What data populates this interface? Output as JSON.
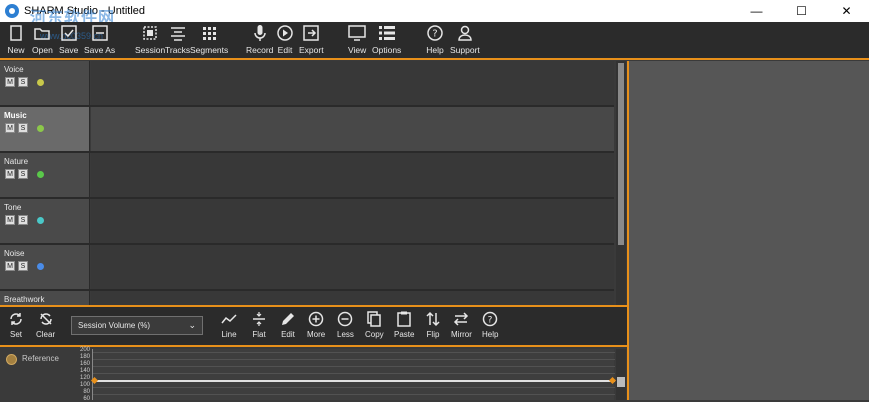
{
  "window": {
    "title": "SHARM Studio - Untitled",
    "watermark": "河东软件网",
    "watermark_url": "www.pc0359.cn",
    "controls": [
      "—",
      "☐",
      "✕"
    ]
  },
  "toolbar": {
    "buttons": [
      {
        "label": "New",
        "icon": "new-file-icon"
      },
      {
        "label": "Open",
        "icon": "folder-open-icon"
      },
      {
        "label": "Save",
        "icon": "save-icon"
      },
      {
        "label": "Save As",
        "icon": "save-as-icon"
      },
      {
        "label": "Session",
        "icon": "session-icon"
      },
      {
        "label": "Tracks",
        "icon": "tracks-icon"
      },
      {
        "label": "Segments",
        "icon": "segments-icon"
      },
      {
        "label": "Record",
        "icon": "microphone-icon"
      },
      {
        "label": "Edit",
        "icon": "play-edit-icon"
      },
      {
        "label": "Export",
        "icon": "export-icon"
      },
      {
        "label": "View",
        "icon": "monitor-icon"
      },
      {
        "label": "Options",
        "icon": "options-icon"
      },
      {
        "label": "Help",
        "icon": "help-icon"
      },
      {
        "label": "Support",
        "icon": "user-icon"
      }
    ]
  },
  "tracks": [
    {
      "name": "Voice",
      "mute": "M",
      "solo": "S",
      "color": "#c8c84a",
      "selected": false
    },
    {
      "name": "Music",
      "mute": "M",
      "solo": "S",
      "color": "#8cc84a",
      "selected": true
    },
    {
      "name": "Nature",
      "mute": "M",
      "solo": "S",
      "color": "#5ac84a",
      "selected": false
    },
    {
      "name": "Tone",
      "mute": "M",
      "solo": "S",
      "color": "#4ac8c8",
      "selected": false
    },
    {
      "name": "Noise",
      "mute": "M",
      "solo": "S",
      "color": "#4a8ce8",
      "selected": false
    },
    {
      "name": "Breathwork",
      "mute": "",
      "solo": "",
      "color": "",
      "selected": false
    }
  ],
  "envelope_toolbar": {
    "left_buttons": [
      {
        "label": "Set",
        "icon": "refresh-icon"
      },
      {
        "label": "Clear",
        "icon": "clear-icon"
      }
    ],
    "select_value": "Session Volume (%)",
    "buttons": [
      {
        "label": "Line",
        "icon": "line-icon"
      },
      {
        "label": "Flat",
        "icon": "flat-icon"
      },
      {
        "label": "Edit",
        "icon": "pencil-icon"
      },
      {
        "label": "More",
        "icon": "plus-circle-icon"
      },
      {
        "label": "Less",
        "icon": "minus-circle-icon"
      },
      {
        "label": "Copy",
        "icon": "copy-icon"
      },
      {
        "label": "Paste",
        "icon": "paste-icon"
      },
      {
        "label": "Flip",
        "icon": "flip-icon"
      },
      {
        "label": "Mirror",
        "icon": "mirror-icon"
      },
      {
        "label": "Help",
        "icon": "help-icon"
      }
    ]
  },
  "graph": {
    "reference_label": "Reference",
    "y_ticks": [
      "200",
      "180",
      "160",
      "140",
      "120",
      "100",
      "80",
      "60"
    ],
    "level": 100
  },
  "colors": {
    "accent": "#e8901a"
  }
}
